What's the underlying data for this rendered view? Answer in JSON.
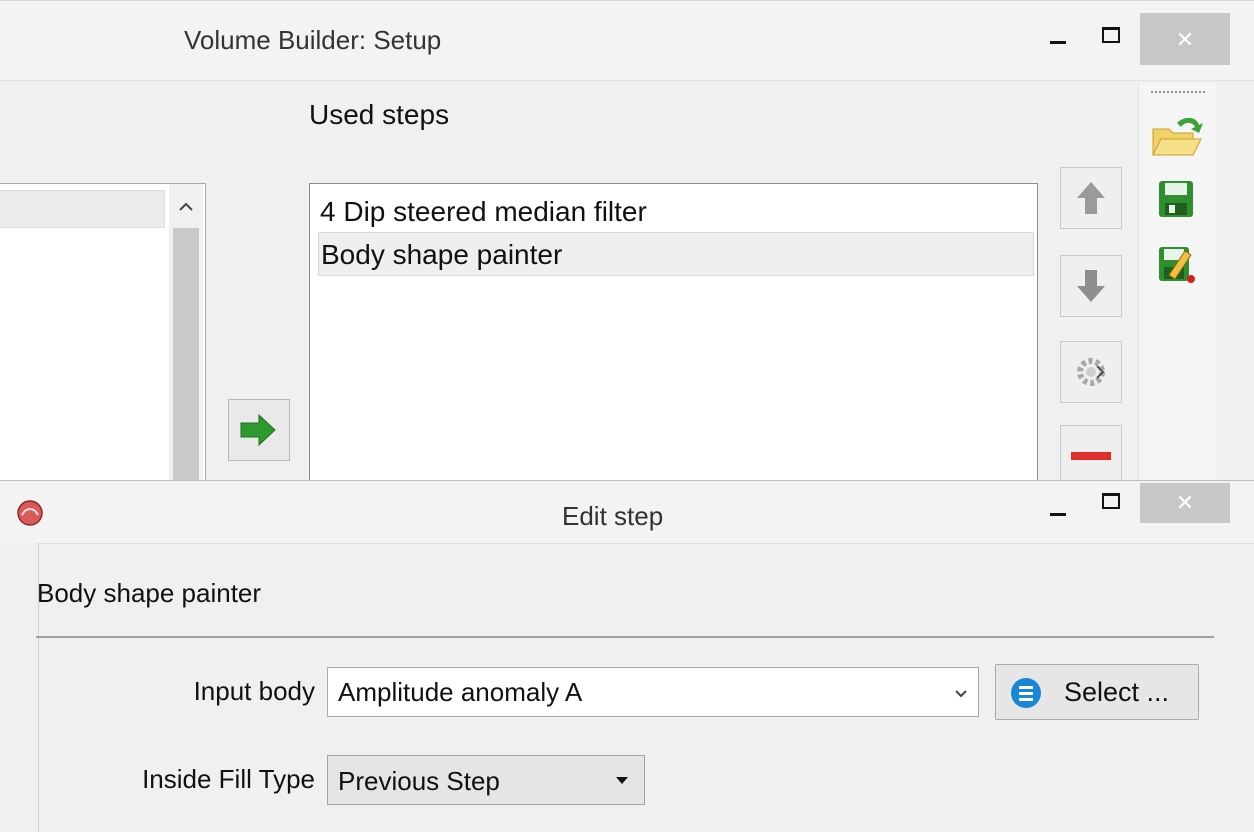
{
  "setup_window": {
    "title": "Volume Builder: Setup",
    "used_steps_label": "Used steps",
    "used_steps": [
      "4 Dip steered median filter",
      "Body shape painter"
    ],
    "selected_step_index": 1,
    "controls": {
      "add_icon": "green-arrow-right-icon",
      "move_up_icon": "arrow-up-icon",
      "move_down_icon": "arrow-down-icon",
      "properties_icon": "gear-icon",
      "remove_icon": "minus-icon"
    },
    "toolbar": [
      "open-folder-icon",
      "save-icon",
      "save-as-icon"
    ]
  },
  "edit_window": {
    "title": "Edit step",
    "step_name": "Body shape painter",
    "input_body_label": "Input body",
    "input_body_value": "Amplitude anomaly A",
    "select_button_label": "Select ...",
    "inside_fill_label": "Inside Fill Type",
    "inside_fill_value": "Previous Step"
  },
  "colors": {
    "accent_green": "#2e9a2e",
    "remove_red": "#e0302a",
    "select_icon_blue": "#1a86d8",
    "close_button": "#c7c7c7"
  }
}
